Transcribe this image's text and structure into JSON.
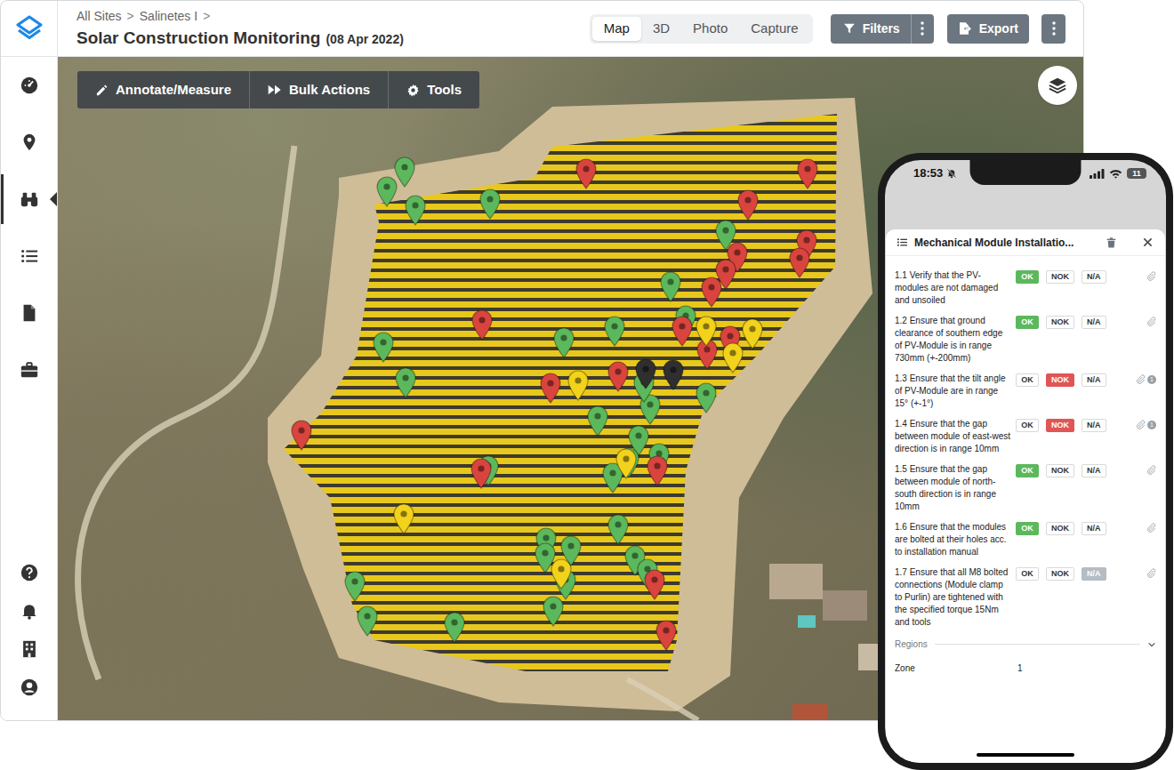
{
  "header": {
    "breadcrumb": [
      {
        "label": "All Sites"
      },
      {
        "label": "Salinetes I"
      }
    ],
    "breadcrumb_separator": ">",
    "title": "Solar Construction Monitoring",
    "date": "(08 Apr 2022)"
  },
  "view_tabs": [
    {
      "label": "Map",
      "selected": true
    },
    {
      "label": "3D",
      "selected": false
    },
    {
      "label": "Photo",
      "selected": false
    },
    {
      "label": "Capture",
      "selected": false
    }
  ],
  "actions": {
    "filters": "Filters",
    "export": "Export"
  },
  "sidebar": {
    "top_items": [
      {
        "selected": false
      },
      {
        "selected": false
      },
      {
        "selected": true
      },
      {
        "selected": false
      },
      {
        "selected": false
      },
      {
        "selected": false
      }
    ],
    "bottom_items": [
      {
        "selected": false
      },
      {
        "selected": false
      },
      {
        "selected": false
      },
      {
        "selected": false
      }
    ]
  },
  "map_toolbar": [
    {
      "label": "Annotate/Measure"
    },
    {
      "label": "Bulk Actions"
    },
    {
      "label": "Tools"
    }
  ],
  "map_pins": [
    {
      "color": "#5cb85c"
    },
    {
      "color": "#5cb85c"
    },
    {
      "color": "#5cb85c"
    },
    {
      "color": "#5cb85c"
    },
    {
      "color": "#5cb85c"
    },
    {
      "color": "#5cb85c"
    },
    {
      "color": "#5cb85c"
    },
    {
      "color": "#5cb85c"
    },
    {
      "color": "#5cb85c"
    },
    {
      "color": "#5cb85c"
    },
    {
      "color": "#5cb85c"
    },
    {
      "color": "#5cb85c"
    },
    {
      "color": "#5cb85c"
    },
    {
      "color": "#5cb85c"
    },
    {
      "color": "#5cb85c"
    },
    {
      "color": "#5cb85c"
    },
    {
      "color": "#5cb85c"
    },
    {
      "color": "#5cb85c"
    },
    {
      "color": "#5cb85c"
    },
    {
      "color": "#5cb85c"
    },
    {
      "color": "#5cb85c"
    },
    {
      "color": "#5cb85c"
    },
    {
      "color": "#5cb85c"
    },
    {
      "color": "#5cb85c"
    },
    {
      "color": "#5cb85c"
    },
    {
      "color": "#5cb85c"
    },
    {
      "color": "#5cb85c"
    },
    {
      "color": "#5cb85c"
    },
    {
      "color": "#5cb85c"
    },
    {
      "color": "#5cb85c"
    },
    {
      "color": "#5cb85c"
    },
    {
      "color": "#d9443f"
    },
    {
      "color": "#d9443f"
    },
    {
      "color": "#d9443f"
    },
    {
      "color": "#d9443f"
    },
    {
      "color": "#d9443f"
    },
    {
      "color": "#d9443f"
    },
    {
      "color": "#d9443f"
    },
    {
      "color": "#d9443f"
    },
    {
      "color": "#d9443f"
    },
    {
      "color": "#d9443f"
    },
    {
      "color": "#d9443f"
    },
    {
      "color": "#d9443f"
    },
    {
      "color": "#d9443f"
    },
    {
      "color": "#d9443f"
    },
    {
      "color": "#d9443f"
    },
    {
      "color": "#d9443f"
    },
    {
      "color": "#d9443f"
    },
    {
      "color": "#d9443f"
    },
    {
      "color": "#d9443f"
    },
    {
      "color": "#f2d21b"
    },
    {
      "color": "#f2d21b"
    },
    {
      "color": "#f2d21b"
    },
    {
      "color": "#f2d21b"
    },
    {
      "color": "#f2d21b"
    },
    {
      "color": "#f2d21b"
    },
    {
      "color": "#f2d21b"
    },
    {
      "color": "#2f2f2f"
    },
    {
      "color": "#2f2f2f"
    }
  ],
  "phone": {
    "status_bar": {
      "time": "18:53",
      "battery": "11"
    },
    "sheet": {
      "title": "Mechanical Module Installatio...",
      "items": [
        {
          "label": "1.1 Verify that the PV-modules are not damaged and unsoiled",
          "options": [
            {
              "label": "OK",
              "selected": true,
              "color": "#5cb85c"
            },
            {
              "label": "NOK",
              "selected": false,
              "color": "#e05656"
            },
            {
              "label": "N/A",
              "selected": false,
              "color": "#b4bcc4"
            }
          ]
        },
        {
          "label": "1.2 Ensure that ground clearance of southern edge of PV-Module is in range 730mm (+-200mm)",
          "options": [
            {
              "label": "OK",
              "selected": true,
              "color": "#5cb85c"
            },
            {
              "label": "NOK",
              "selected": false,
              "color": "#e05656"
            },
            {
              "label": "N/A",
              "selected": false,
              "color": "#b4bcc4"
            }
          ]
        },
        {
          "label": "1.3 Ensure that the tilt angle of PV-Module are in range 15° (+-1°)",
          "options": [
            {
              "label": "OK",
              "selected": false,
              "color": "#5cb85c"
            },
            {
              "label": "NOK",
              "selected": true,
              "color": "#e05656"
            },
            {
              "label": "N/A",
              "selected": false,
              "color": "#b4bcc4"
            }
          ],
          "attachments": "1"
        },
        {
          "label": "1.4 Ensure that the gap between module of east-west direction is in range 10mm",
          "options": [
            {
              "label": "OK",
              "selected": false,
              "color": "#5cb85c"
            },
            {
              "label": "NOK",
              "selected": true,
              "color": "#e05656"
            },
            {
              "label": "N/A",
              "selected": false,
              "color": "#b4bcc4"
            }
          ],
          "attachments": "1"
        },
        {
          "label": "1.5 Ensure that the gap between module of north-south direction is in range 10mm",
          "options": [
            {
              "label": "OK",
              "selected": true,
              "color": "#5cb85c"
            },
            {
              "label": "NOK",
              "selected": false,
              "color": "#e05656"
            },
            {
              "label": "N/A",
              "selected": false,
              "color": "#b4bcc4"
            }
          ]
        },
        {
          "label": "1.6 Ensure that the modules are bolted at their holes acc. to installation manual",
          "options": [
            {
              "label": "OK",
              "selected": true,
              "color": "#5cb85c"
            },
            {
              "label": "NOK",
              "selected": false,
              "color": "#e05656"
            },
            {
              "label": "N/A",
              "selected": false,
              "color": "#b4bcc4"
            }
          ]
        },
        {
          "label": "1.7 Ensure that all M8 bolted connections (Module clamp to Purlin) are tightened with the specified torque 15Nm and tools",
          "options": [
            {
              "label": "OK",
              "selected": false,
              "color": "#5cb85c"
            },
            {
              "label": "NOK",
              "selected": false,
              "color": "#e05656"
            },
            {
              "label": "N/A",
              "selected": true,
              "color": "#b4bcc4"
            }
          ]
        }
      ],
      "regions_label": "Regions",
      "fields": [
        {
          "label": "Zone",
          "value": "1"
        }
      ]
    }
  }
}
